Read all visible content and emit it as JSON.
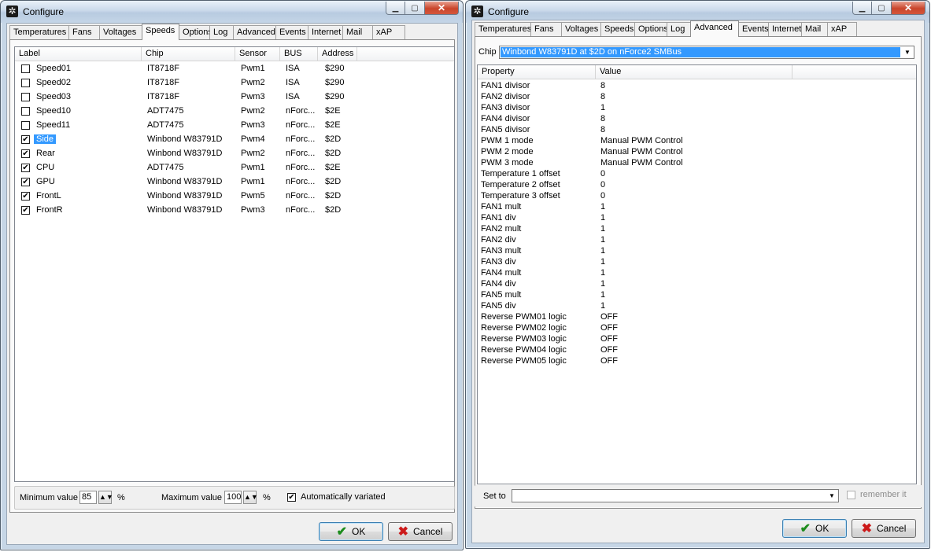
{
  "left_window": {
    "title": "Configure",
    "tabs": [
      "Temperatures",
      "Fans",
      "Voltages",
      "Speeds",
      "Options",
      "Log",
      "Advanced",
      "Events",
      "Internet",
      "Mail",
      "xAP"
    ],
    "active_tab": "Speeds",
    "columns": [
      "Label",
      "Chip",
      "Sensor",
      "BUS",
      "Address"
    ],
    "rows": [
      {
        "checked": false,
        "label": "Speed01",
        "chip": "IT8718F",
        "sensor": "Pwm1",
        "bus": "ISA",
        "address": "$290"
      },
      {
        "checked": false,
        "label": "Speed02",
        "chip": "IT8718F",
        "sensor": "Pwm2",
        "bus": "ISA",
        "address": "$290"
      },
      {
        "checked": false,
        "label": "Speed03",
        "chip": "IT8718F",
        "sensor": "Pwm3",
        "bus": "ISA",
        "address": "$290"
      },
      {
        "checked": false,
        "label": "Speed10",
        "chip": "ADT7475",
        "sensor": "Pwm2",
        "bus": "nForc...",
        "address": "$2E"
      },
      {
        "checked": false,
        "label": "Speed11",
        "chip": "ADT7475",
        "sensor": "Pwm3",
        "bus": "nForc...",
        "address": "$2E"
      },
      {
        "checked": true,
        "label": "Side",
        "chip": "Winbond W83791D",
        "sensor": "Pwm4",
        "bus": "nForc...",
        "address": "$2D",
        "selected": true
      },
      {
        "checked": true,
        "label": "Rear",
        "chip": "Winbond W83791D",
        "sensor": "Pwm2",
        "bus": "nForc...",
        "address": "$2D"
      },
      {
        "checked": true,
        "label": "CPU",
        "chip": "ADT7475",
        "sensor": "Pwm1",
        "bus": "nForc...",
        "address": "$2E"
      },
      {
        "checked": true,
        "label": "GPU",
        "chip": "Winbond W83791D",
        "sensor": "Pwm1",
        "bus": "nForc...",
        "address": "$2D"
      },
      {
        "checked": true,
        "label": "FrontL",
        "chip": "Winbond W83791D",
        "sensor": "Pwm5",
        "bus": "nForc...",
        "address": "$2D"
      },
      {
        "checked": true,
        "label": "FrontR",
        "chip": "Winbond W83791D",
        "sensor": "Pwm3",
        "bus": "nForc...",
        "address": "$2D"
      }
    ],
    "min_label": "Minimum value",
    "min_value": "85",
    "max_label": "Maximum value",
    "max_value": "100",
    "percent": "%",
    "auto_label": "Automatically variated",
    "auto_checked": true,
    "ok_label": "OK",
    "cancel_label": "Cancel"
  },
  "right_window": {
    "title": "Configure",
    "tabs": [
      "Temperatures",
      "Fans",
      "Voltages",
      "Speeds",
      "Options",
      "Log",
      "Advanced",
      "Events",
      "Internet",
      "Mail",
      "xAP"
    ],
    "active_tab": "Advanced",
    "chip_label": "Chip",
    "chip_value": "Winbond W83791D at $2D on nForce2 SMBus",
    "columns": [
      "Property",
      "Value"
    ],
    "properties": [
      {
        "property": "FAN1 divisor",
        "value": "8"
      },
      {
        "property": "FAN2 divisor",
        "value": "8"
      },
      {
        "property": "FAN3 divisor",
        "value": "1"
      },
      {
        "property": "FAN4 divisor",
        "value": "8"
      },
      {
        "property": "FAN5 divisor",
        "value": "8"
      },
      {
        "property": "PWM 1 mode",
        "value": "Manual PWM Control"
      },
      {
        "property": "PWM 2 mode",
        "value": "Manual PWM Control"
      },
      {
        "property": "PWM 3 mode",
        "value": "Manual PWM Control"
      },
      {
        "property": "Temperature 1 offset",
        "value": "0"
      },
      {
        "property": "Temperature 2 offset",
        "value": "0"
      },
      {
        "property": "Temperature 3 offset",
        "value": "0"
      },
      {
        "property": "FAN1 mult",
        "value": "1"
      },
      {
        "property": "FAN1 div",
        "value": "1"
      },
      {
        "property": "FAN2 mult",
        "value": "1"
      },
      {
        "property": "FAN2 div",
        "value": "1"
      },
      {
        "property": "FAN3 mult",
        "value": "1"
      },
      {
        "property": "FAN3 div",
        "value": "1"
      },
      {
        "property": "FAN4 mult",
        "value": "1"
      },
      {
        "property": "FAN4 div",
        "value": "1"
      },
      {
        "property": "FAN5 mult",
        "value": "1"
      },
      {
        "property": "FAN5 div",
        "value": "1"
      },
      {
        "property": "Reverse PWM01 logic",
        "value": "OFF"
      },
      {
        "property": "Reverse PWM02 logic",
        "value": "OFF"
      },
      {
        "property": "Reverse PWM03 logic",
        "value": "OFF"
      },
      {
        "property": "Reverse PWM04 logic",
        "value": "OFF"
      },
      {
        "property": "Reverse PWM05 logic",
        "value": "OFF"
      }
    ],
    "set_to_label": "Set to",
    "set_to_value": "",
    "remember_label": "remember it",
    "remember_checked": false,
    "ok_label": "OK",
    "cancel_label": "Cancel"
  },
  "icons": {
    "app": "fan-icon",
    "minimize": "minimize-icon",
    "maximize": "maximize-icon",
    "close": "close-icon",
    "ok": "checkmark-icon",
    "cancel": "x-icon"
  },
  "colors": {
    "selection": "#3399ff",
    "ok_green": "#1c8c1c",
    "cancel_red": "#cc1a1a"
  }
}
